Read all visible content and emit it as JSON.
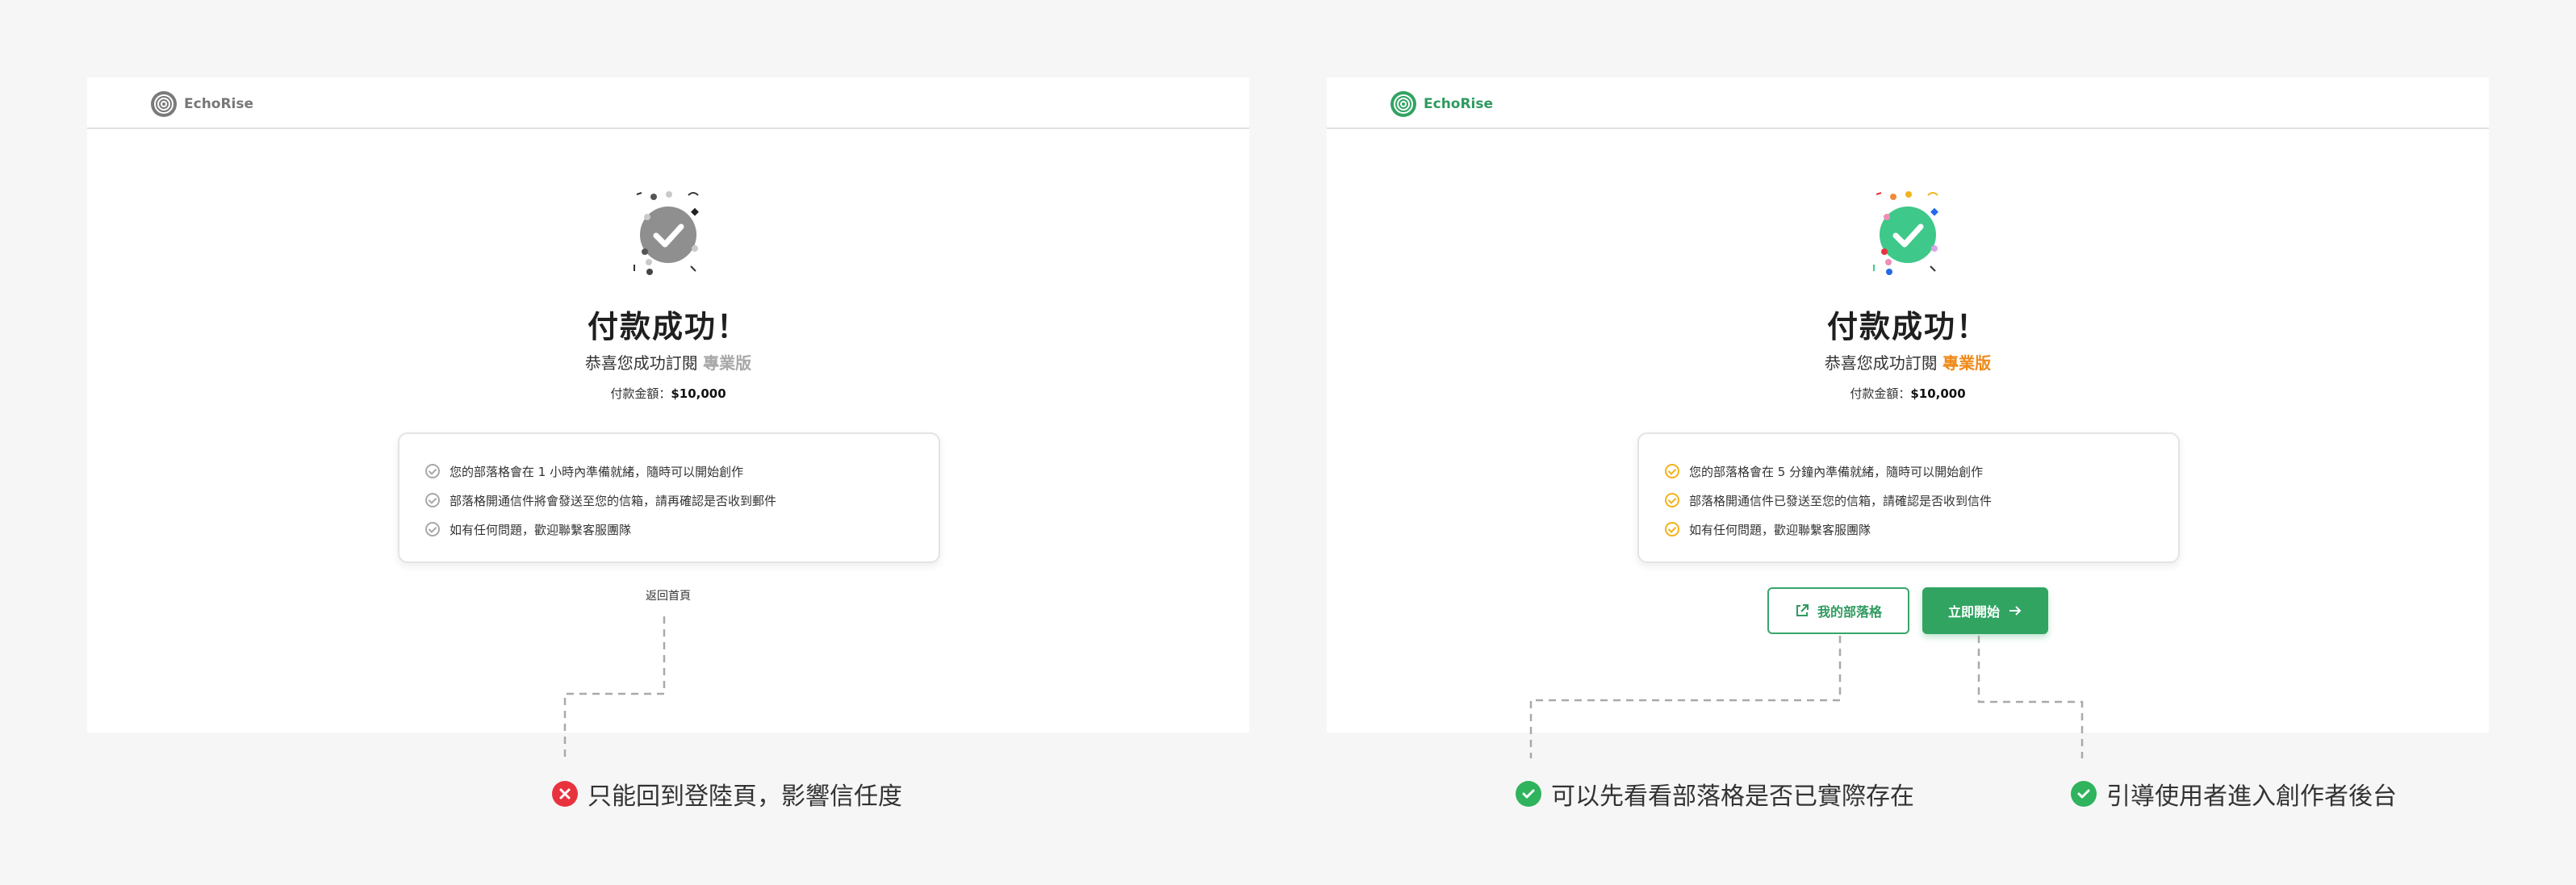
{
  "colors": {
    "accent_green": "#31a462",
    "accent_orange": "#ef8a1a",
    "muted_gray": "#a8a8a8",
    "error_red": "#e8333f",
    "success_green": "#2fb35d",
    "check_yellow": "#f2b21b"
  },
  "before": {
    "brand": {
      "name": "EchoRise",
      "icon": "logo-icon"
    },
    "title": "付款成功！",
    "subtitle_prefix": "恭喜您成功訂閱 ",
    "plan": "專業版",
    "amount_label": "付款金額：",
    "amount_value": "$10,000",
    "items": [
      "您的部落格會在 1 小時內準備就緒，隨時可以開始創作",
      "部落格開通信件將會發送至您的信箱，請再確認是否收到郵件",
      "如有任何問題，歡迎聯繫客服團隊"
    ],
    "home_link": "返回首頁"
  },
  "after": {
    "brand": {
      "name": "EchoRise",
      "icon": "logo-icon"
    },
    "title": "付款成功！",
    "subtitle_prefix": "恭喜您成功訂閱 ",
    "plan": "專業版",
    "amount_label": "付款金額：",
    "amount_value": "$10,000",
    "items": [
      "您的部落格會在 5 分鐘內準備就緒，隨時可以開始創作",
      "部落格開通信件已發送至您的信箱，請確認是否收到信件",
      "如有任何問題，歡迎聯繫客服團隊"
    ],
    "my_blog_button": "我的部落格",
    "start_button": "立即開始"
  },
  "callouts": {
    "bad": "只能回到登陸頁，影響信任度",
    "good_1": "可以先看看部落格是否已實際存在",
    "good_2": "引導使用者進入創作者後台"
  }
}
